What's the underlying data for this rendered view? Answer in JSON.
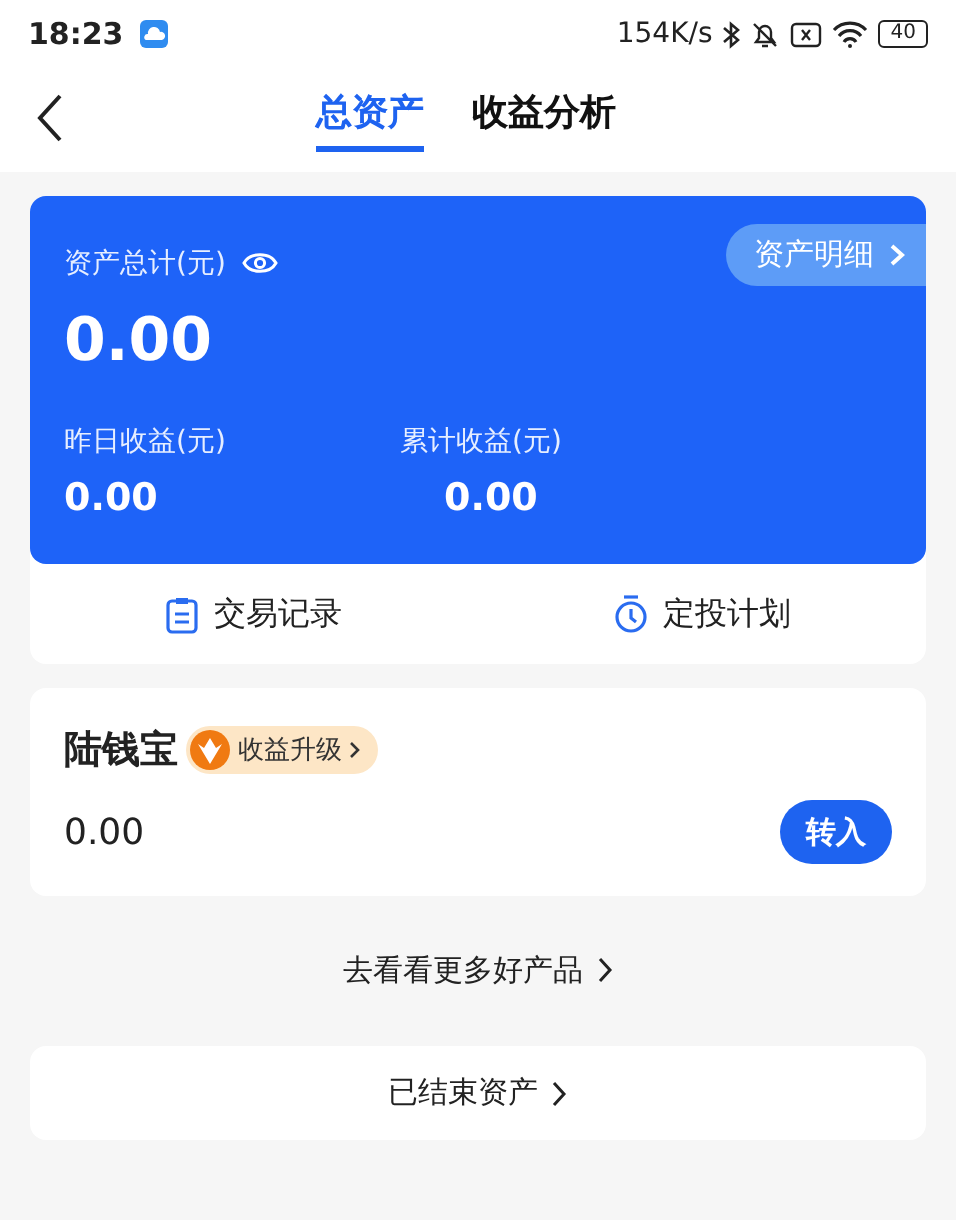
{
  "status_bar": {
    "time": "18:23",
    "speed": "154K/s",
    "battery": "40"
  },
  "tabs": [
    {
      "label": "总资产",
      "selected": true
    },
    {
      "label": "收益分析",
      "selected": false
    }
  ],
  "summary": {
    "total_label": "资产总计(元)",
    "total_value": "0.00",
    "detail_button": "资产明细",
    "stats": [
      {
        "label": "昨日收益(元)",
        "value": "0.00"
      },
      {
        "label": "累计收益(元)",
        "value": "0.00"
      }
    ]
  },
  "actions": [
    {
      "label": "交易记录",
      "kind": "record"
    },
    {
      "label": "定投计划",
      "kind": "timer"
    }
  ],
  "product": {
    "name": "陆钱宝",
    "badge": "收益升级",
    "value": "0.00",
    "button": "转入"
  },
  "more_link": "去看看更多好产品",
  "ended_link": "已结束资产"
}
